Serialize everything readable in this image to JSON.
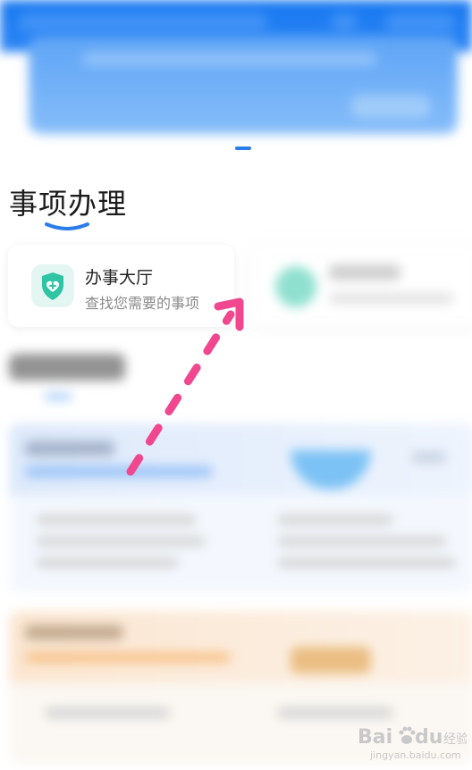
{
  "section": {
    "title": "事项办理"
  },
  "cards": [
    {
      "title": "办事大厅",
      "subtitle": "查找您需要的事项"
    }
  ],
  "watermark": {
    "brand": "Bai",
    "brand2": "du",
    "suffix": "经验",
    "url": "jingyan.baidu.com"
  },
  "colors": {
    "status_bar": "#1677f0",
    "accent_blue": "#2b7de9",
    "arrow_pink": "#f0478f",
    "card_icon_bg": "#e4f6f2",
    "card_icon_fg": "#2ec4a4"
  },
  "icons": {
    "card_icon": "shield-heart-icon"
  }
}
